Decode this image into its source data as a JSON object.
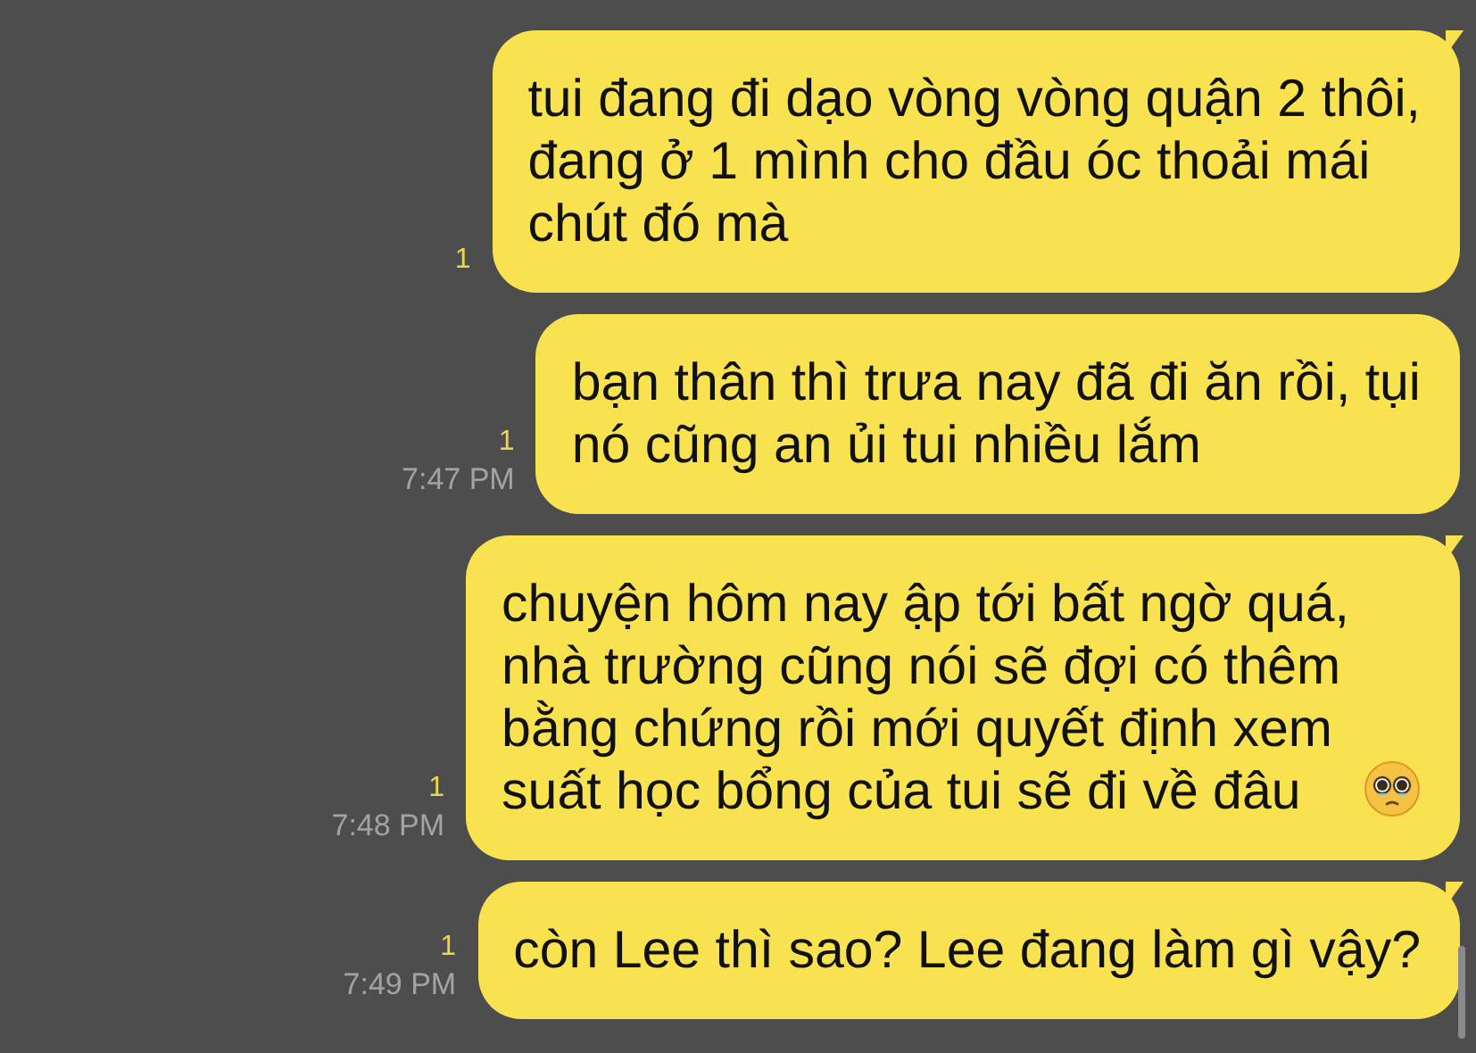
{
  "messages": [
    {
      "text": "tui đang đi dạo vòng vòng quận 2 thôi,\nđang ở 1 mình cho đầu óc thoải mái\nchút đó mà",
      "read_count": "1",
      "tail": true,
      "trailing_emoji": false
    },
    {
      "text": "bạn thân thì trưa nay đã đi ăn rồi, tụi\nnó cũng an ủi tui nhiều lắm",
      "read_count": "1",
      "time": "7:47 PM",
      "tail": false,
      "trailing_emoji": false
    },
    {
      "text": "chuyện hôm nay ập tới bất ngờ quá,\nnhà trường cũng nói sẽ đợi có thêm\nbằng chứng rồi mới quyết định xem\nsuất học bổng của tui sẽ đi về đâu",
      "read_count": "1",
      "time": "7:48 PM",
      "tail": true,
      "trailing_emoji": true
    },
    {
      "text": "còn Lee thì sao? Lee đang làm gì vậy?",
      "read_count": "1",
      "time": "7:49 PM",
      "tail": true,
      "trailing_emoji": false
    }
  ]
}
